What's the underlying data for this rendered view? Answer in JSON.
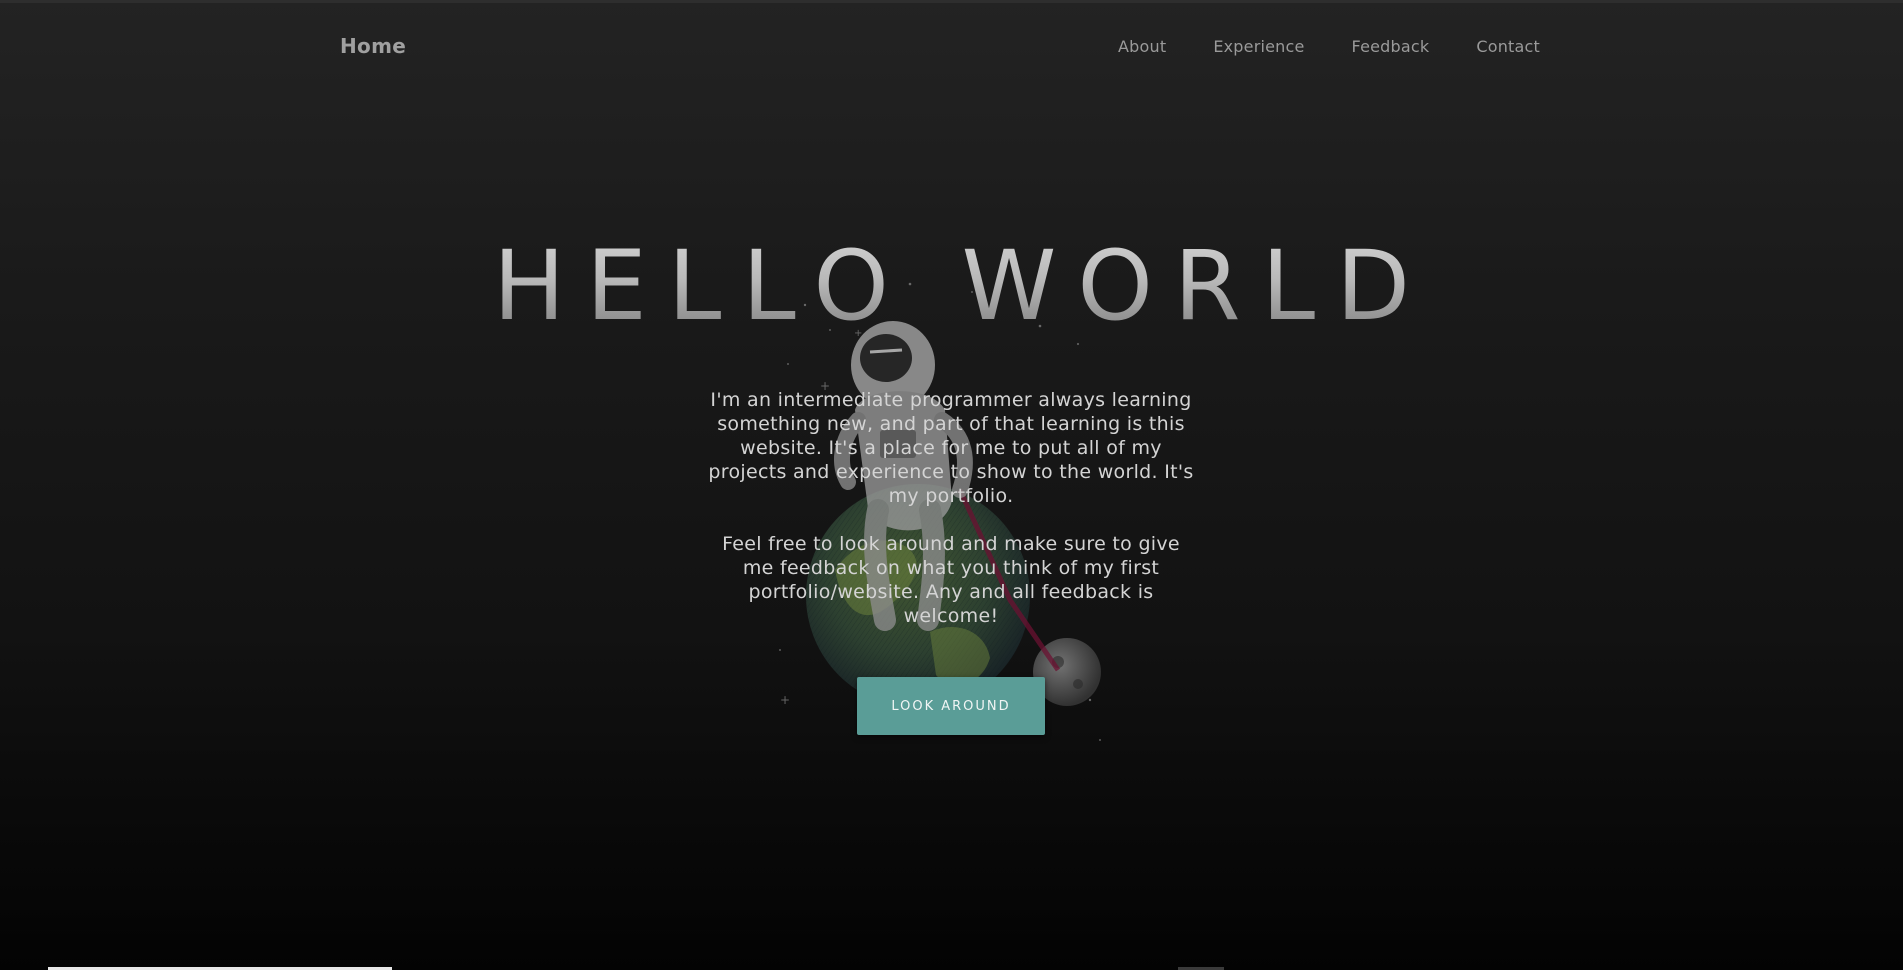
{
  "nav": {
    "home_label": "Home",
    "links": [
      "About",
      "Experience",
      "Feedback",
      "Contact"
    ]
  },
  "hero": {
    "title": "HELLO WORLD",
    "paragraph_1": "I'm an intermediate programmer always learning something new, and part of that learning is this website. It's a place for me to put all of my projects and experience to show to the world. It's my portfolio.",
    "paragraph_2": "Feel free to look around and make sure to give me feedback on what you think of my first portfolio/website. Any and all feedback is welcome!",
    "button_label": "LOOK AROUND"
  },
  "illustration": {
    "icon": "astronaut-on-earth-illustration"
  },
  "colors": {
    "accent": "#5a9d97",
    "background_top": "#232323",
    "background_bottom": "#030303",
    "text": "#d4d4d4"
  }
}
